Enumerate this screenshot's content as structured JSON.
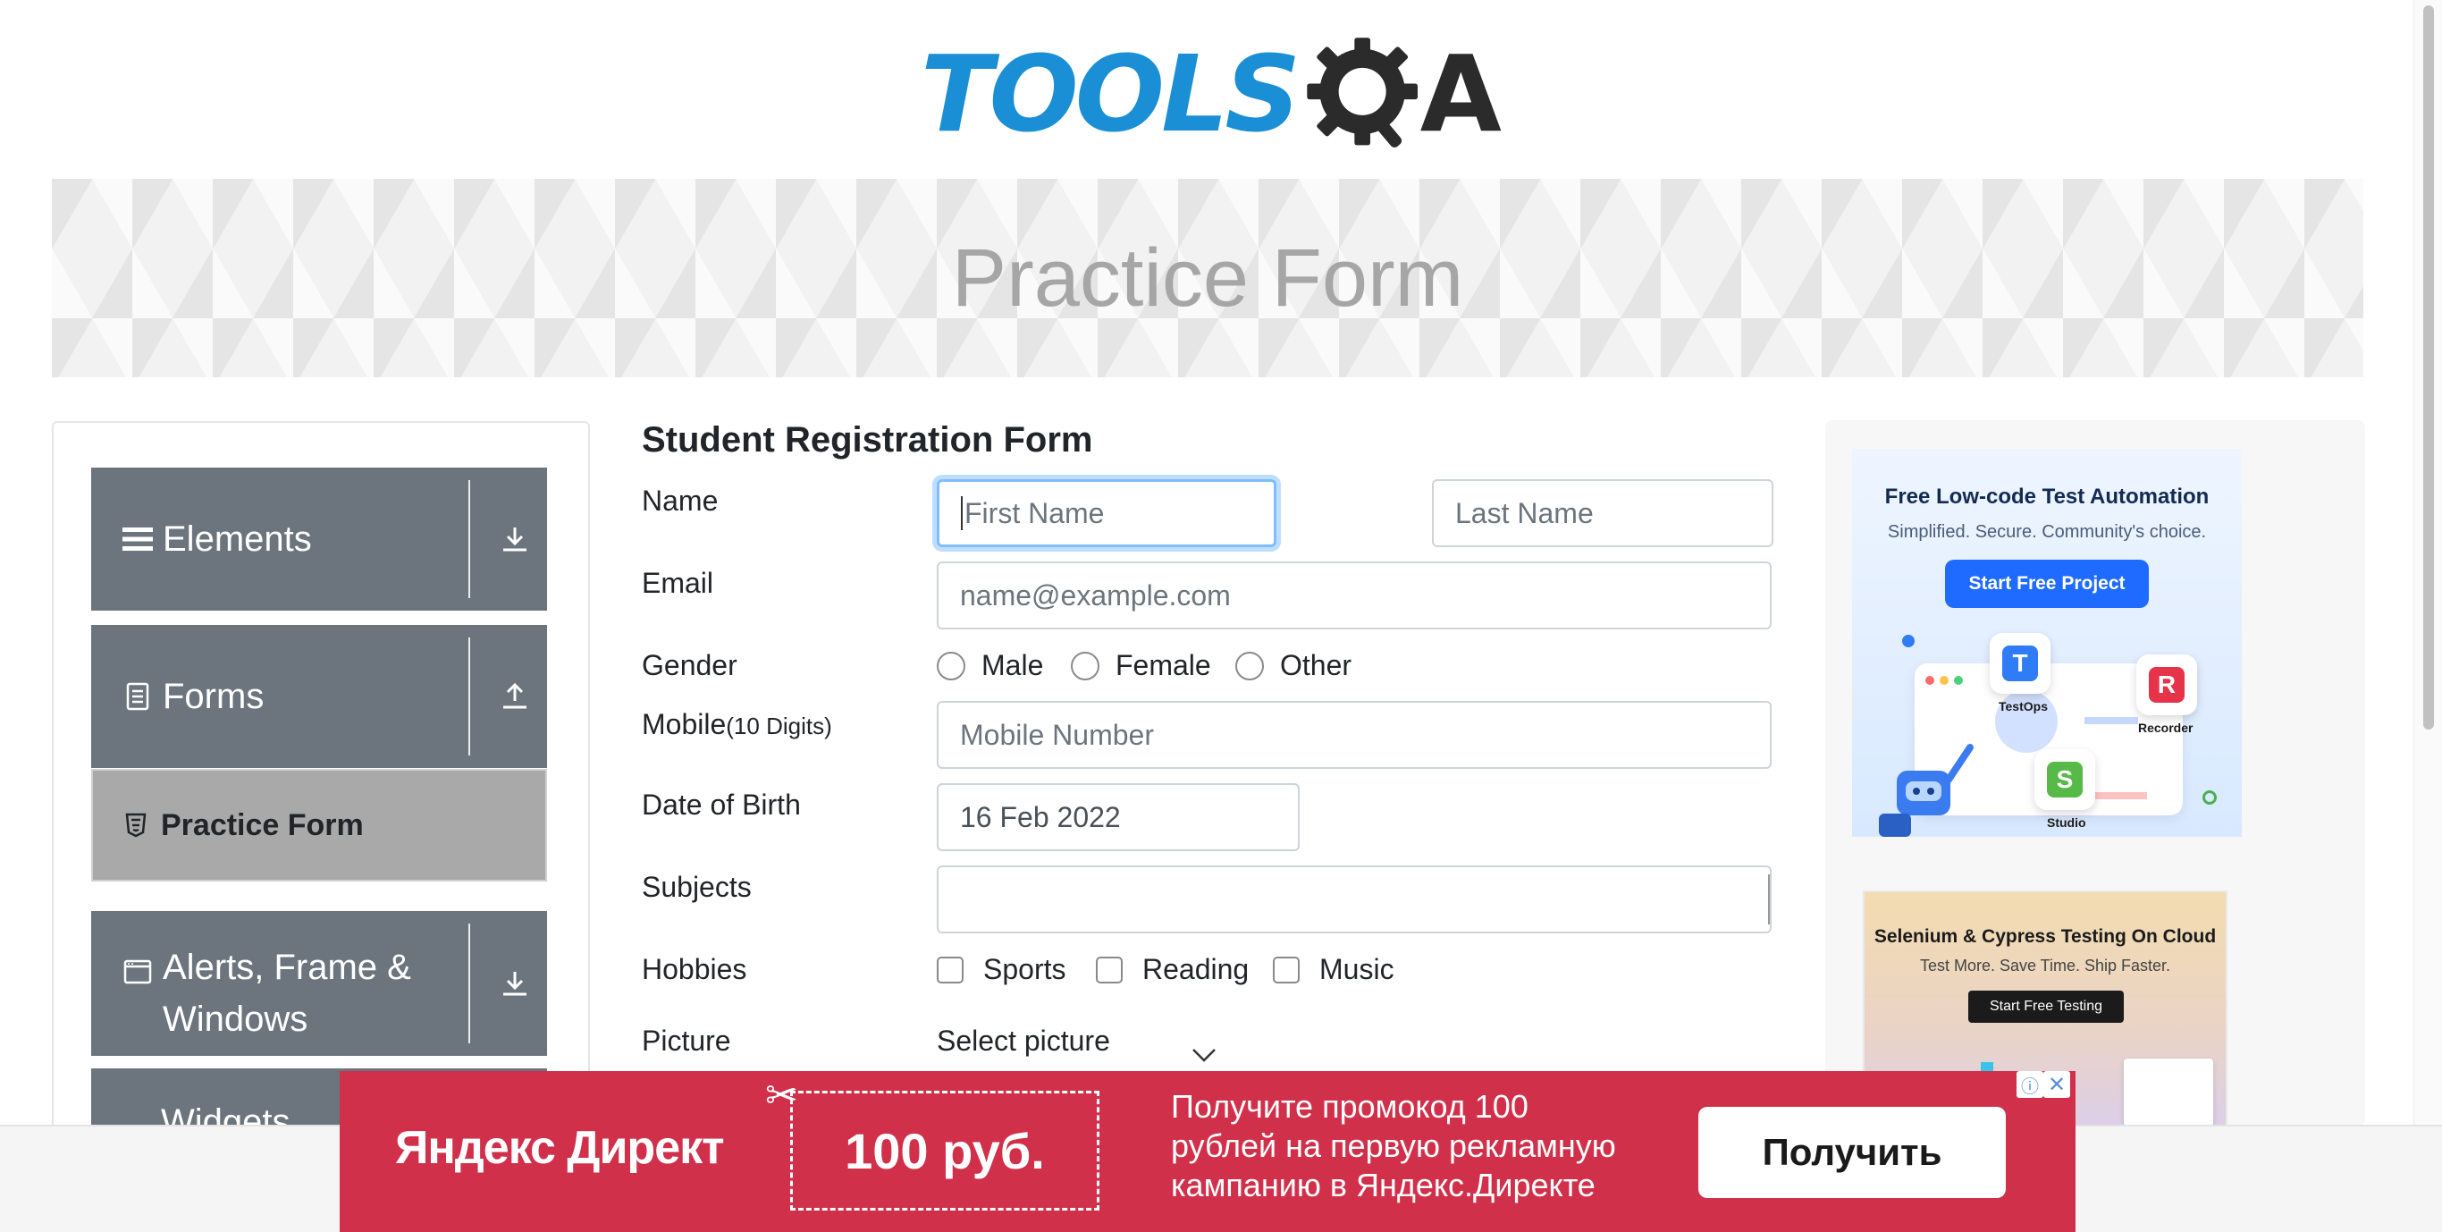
{
  "header": {
    "logo_text": "TOOLS",
    "logo_text_end": "A"
  },
  "banner": {
    "title": "Practice Form"
  },
  "sidebar": {
    "groups": [
      {
        "label": "Elements",
        "icon": "hamburger-icon",
        "toggle": "download-arrow-icon"
      },
      {
        "label": "Forms",
        "icon": "document-icon",
        "toggle": "upload-arrow-icon"
      },
      {
        "label": "Alerts, Frame &",
        "label2": "Windows",
        "icon": "window-icon",
        "toggle": "download-arrow-icon"
      },
      {
        "label": "Widgets"
      }
    ],
    "active_item": {
      "label": "Practice Form",
      "icon": "html5-shield-icon"
    }
  },
  "form": {
    "title": "Student Registration Form",
    "name_label": "Name",
    "first_name_placeholder": "First Name",
    "last_name_placeholder": "Last Name",
    "email_label": "Email",
    "email_placeholder": "name@example.com",
    "gender_label": "Gender",
    "gender_options": [
      "Male",
      "Female",
      "Other"
    ],
    "mobile_label": "Mobile",
    "mobile_hint": "(10 Digits)",
    "mobile_placeholder": "Mobile Number",
    "dob_label": "Date of Birth",
    "dob_value": "16 Feb 2022",
    "subjects_label": "Subjects",
    "subjects_value": "",
    "hobbies_label": "Hobbies",
    "hobbies_options": [
      "Sports",
      "Reading",
      "Music"
    ],
    "picture_label": "Picture",
    "picture_button": "Select picture"
  },
  "ads": {
    "ad1": {
      "title": "Free Low-code Test Automation",
      "subtitle": "Simplified. Secure. Community's choice.",
      "button": "Start Free Project",
      "badges": [
        "TestOps",
        "Recorder",
        "Studio"
      ],
      "badge_letters": [
        "T",
        "R",
        "S"
      ]
    },
    "ad2": {
      "title": "Selenium & Cypress Testing On Cloud",
      "subtitle": "Test More. Save Time. Ship Faster.",
      "button": "Start Free Testing"
    },
    "yandex": {
      "brand": "Яндекс Директ",
      "coupon": "100 руб.",
      "message_line1": "Получите промокод 100",
      "message_line2": "рублей на первую рекламную",
      "message_line3": "кампанию в Яндекс.Директе",
      "cta": "Получить",
      "info": "ⓘ",
      "close": "✕"
    }
  },
  "colors": {
    "sidebar_group_bg": "#6c757d",
    "active_item_bg": "#a9a9a9",
    "focus_border": "#80bdff",
    "yandex_bg": "#d1304a",
    "logo_blue": "#1a8fd6"
  }
}
